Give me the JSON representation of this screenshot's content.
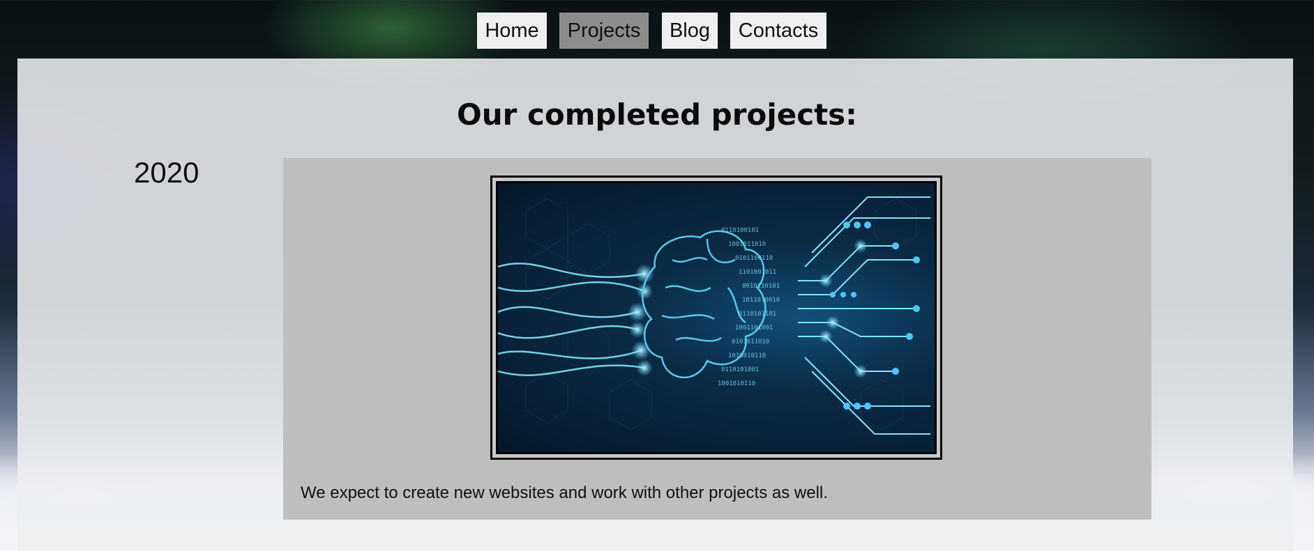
{
  "nav": {
    "items": [
      {
        "label": "Home"
      },
      {
        "label": "Projects",
        "active": true
      },
      {
        "label": "Blog"
      },
      {
        "label": "Contacts"
      }
    ]
  },
  "main": {
    "heading": "Our completed projects:",
    "projects": [
      {
        "year": "2020",
        "image_icon": "ai-brain-circuit-image",
        "caption": "We expect to create new websites and work with other projects as well."
      }
    ]
  },
  "colors": {
    "nav_bg": "#efefef",
    "nav_active_bg": "#8c8c8c",
    "card_bg": "#bebebe",
    "panel_bg": "#eceef0"
  }
}
